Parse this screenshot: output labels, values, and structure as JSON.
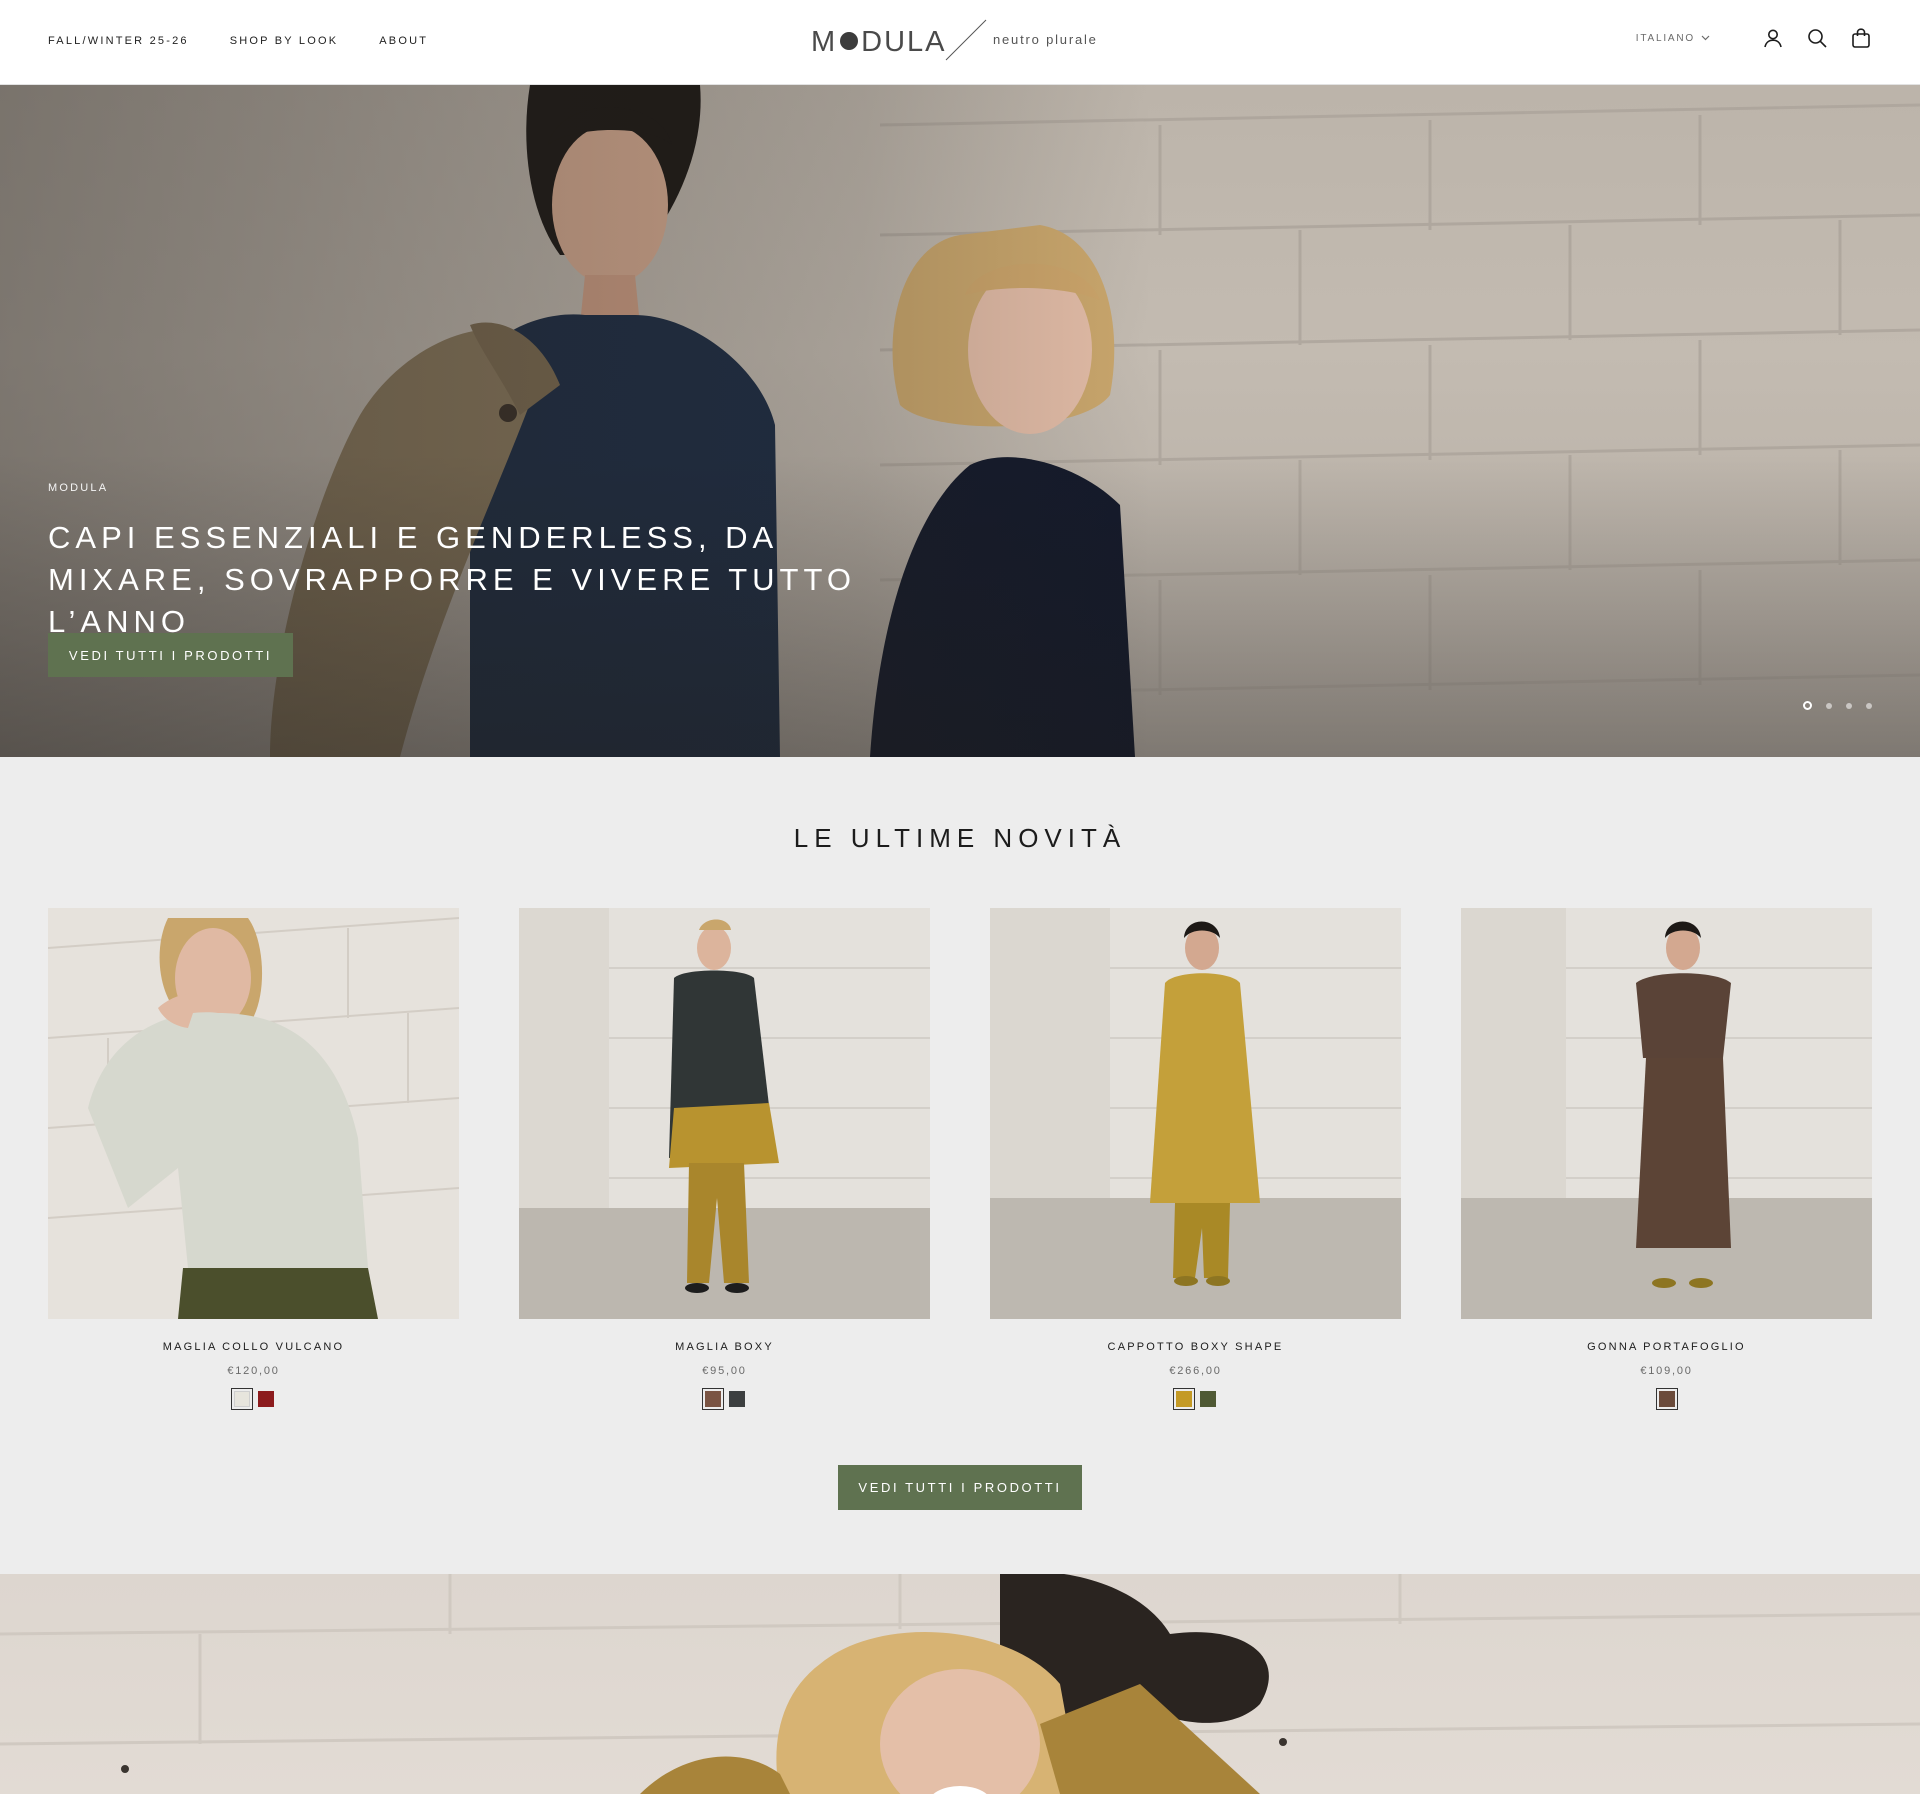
{
  "header": {
    "nav": [
      "FALL/WINTER 25-26",
      "SHOP BY LOOK",
      "ABOUT"
    ],
    "logo": {
      "word_left": "M",
      "word_right": "DULA",
      "tagline": "neutro plurale"
    },
    "language": "ITALIANO",
    "icons": [
      "account-icon",
      "search-icon",
      "bag-icon"
    ]
  },
  "hero": {
    "kicker": "MODULA",
    "title": "CAPI ESSENZIALI E GENDERLESS, DA MIXARE, SOVRAPPORRE E VIVERE TUTTO L’ANNO",
    "cta": "VEDI TUTTI I PRODOTTI",
    "slides": 4,
    "active_slide": 1
  },
  "latest": {
    "title": "LE ULTIME NOVITÀ",
    "products": [
      {
        "name": "MAGLIA COLLO VULCANO",
        "price": "€120,00",
        "swatches": [
          "#e7e5dd",
          "#8c1b1d"
        ],
        "selected": 0
      },
      {
        "name": "MAGLIA BOXY",
        "price": "€95,00",
        "swatches": [
          "#7a5443",
          "#3c3f40"
        ],
        "selected": 0
      },
      {
        "name": "CAPPOTTO BOXY SHAPE",
        "price": "€266,00",
        "swatches": [
          "#c49a25",
          "#4f5934"
        ],
        "selected": 0
      },
      {
        "name": "GONNA PORTAFOGLIO",
        "price": "€109,00",
        "swatches": [
          "#6b4b3b"
        ],
        "selected": 0
      }
    ],
    "cta": "VEDI TUTTI I PRODOTTI"
  },
  "colors": {
    "accent": "#5f7250",
    "background": "#ededed"
  }
}
